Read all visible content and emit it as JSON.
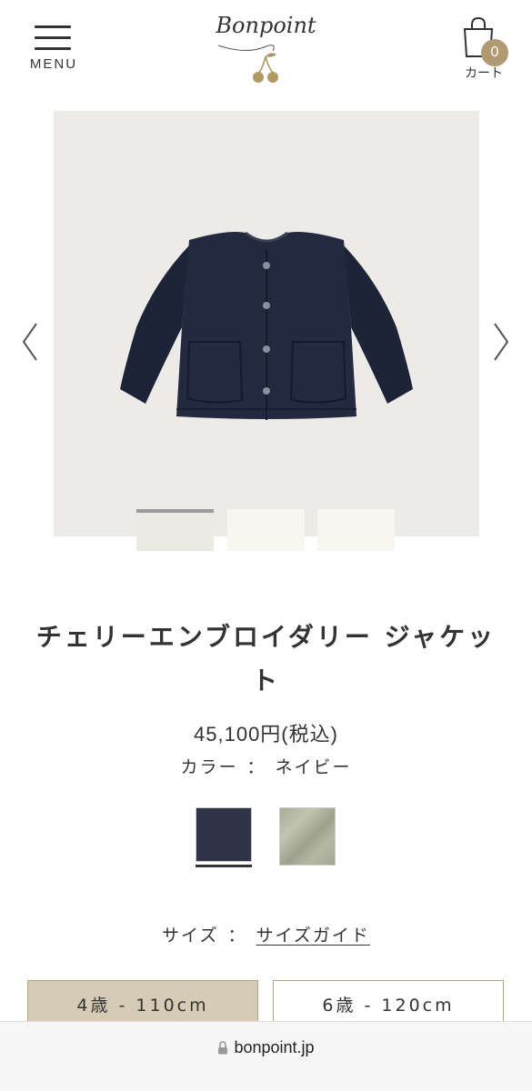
{
  "header": {
    "menu_label": "MENU",
    "logo_text": "Bonpoint",
    "cart_label": "カート",
    "cart_count": "0"
  },
  "gallery": {
    "prev_icon": "chevron-left-icon",
    "next_icon": "chevron-right-icon",
    "thumbnail_count": 3,
    "active_thumbnail": 1
  },
  "product": {
    "title": "チェリーエンブロイダリー ジャケット",
    "price": "45,100円(税込)",
    "color_label": "カラー",
    "separator": "：",
    "color_value": "ネイビー",
    "swatches": [
      {
        "name": "navy",
        "color": "#2f3546",
        "selected": true
      },
      {
        "name": "khaki",
        "color": "#a9ac98",
        "selected": false
      }
    ],
    "size_label": "サイズ",
    "size_guide": "サイズガイド",
    "sizes": [
      {
        "label": "4歳 - 110cm",
        "selected": true
      },
      {
        "label": "6歳 - 120cm",
        "selected": false
      }
    ]
  },
  "browser": {
    "url": "bonpoint.jp"
  },
  "colors": {
    "accent": "#b09a72",
    "selected_size_bg": "#d6ccb6",
    "size_border": "#b5a47e"
  }
}
